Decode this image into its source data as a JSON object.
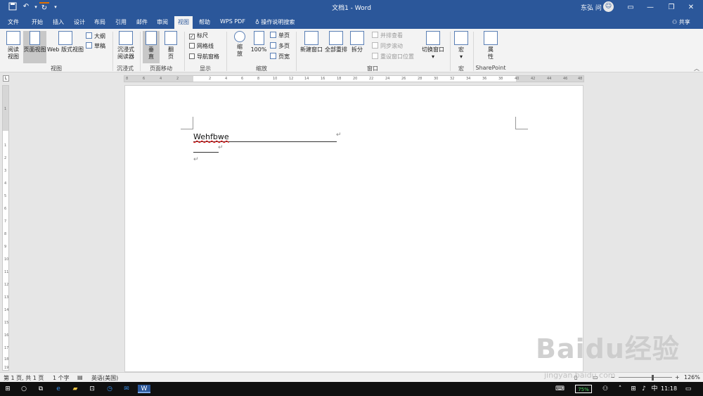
{
  "titlebar": {
    "doc_title": "文档1 - Word",
    "user_name": "东弘 问",
    "avatar_icon": "user-icon",
    "minimize": "—",
    "restore": "❐",
    "close": "✕"
  },
  "tabs": [
    {
      "label": "文件"
    },
    {
      "label": "开始"
    },
    {
      "label": "插入"
    },
    {
      "label": "设计"
    },
    {
      "label": "布局"
    },
    {
      "label": "引用"
    },
    {
      "label": "邮件"
    },
    {
      "label": "审阅"
    },
    {
      "label": "视图"
    },
    {
      "label": "帮助"
    },
    {
      "label": "WPS PDF"
    }
  ],
  "tell_me": "操作说明搜索",
  "share": "共享",
  "ribbon": {
    "views": {
      "read_mode": "阅读视图",
      "print_layout": "页面视图",
      "web_layout": "Web 版式视图",
      "outline": "大纲",
      "draft": "草稿",
      "group": "视图"
    },
    "immersive": {
      "reader": "沉浸式阅读器",
      "group": "沉浸式"
    },
    "page_movement": {
      "vertical": "垂直",
      "side_to_side": "翻页",
      "group": "页面移动"
    },
    "show": {
      "ruler": "标尺",
      "gridlines": "网格线",
      "nav_pane": "导航窗格",
      "group": "显示"
    },
    "zoom": {
      "zoom": "缩放",
      "hundred": "100%",
      "one_page": "单页",
      "multi_page": "多页",
      "page_width": "页宽",
      "group": "缩放"
    },
    "window": {
      "new_window": "新建窗口",
      "arrange_all": "全部重排",
      "split": "拆分",
      "side_by_side": "并排查看",
      "sync_scroll": "同步滚动",
      "reset_pos": "重设窗口位置",
      "switch_windows": "切换窗口",
      "group": "窗口"
    },
    "macros": {
      "macros": "宏",
      "group": "宏"
    },
    "sharepoint": {
      "properties": "属性",
      "group": "SharePoint"
    }
  },
  "hruler_ticks": [
    "8",
    "6",
    "4",
    "2",
    "2",
    "4",
    "6",
    "8",
    "10",
    "12",
    "14",
    "16",
    "18",
    "20",
    "22",
    "24",
    "26",
    "28",
    "30",
    "32",
    "34",
    "36",
    "38",
    "40",
    "42",
    "44",
    "46",
    "48"
  ],
  "vruler_ticks": [
    "1",
    "1",
    "2",
    "3",
    "4",
    "5",
    "6",
    "7",
    "8",
    "9",
    "10",
    "11",
    "12",
    "13",
    "14",
    "15",
    "16",
    "17",
    "18",
    "19"
  ],
  "document": {
    "line1": "Wehfbwe",
    "mark": "↵"
  },
  "statusbar": {
    "page": "第 1 页, 共 1 页",
    "words": "1 个字",
    "language": "英语(美国)",
    "zoom": "126%"
  },
  "taskbar": {
    "battery": "75%",
    "ime": "中",
    "time": "11:18"
  },
  "watermark": {
    "brand": "Baidu经验",
    "url": "jingyan.baidu.com"
  },
  "colors": {
    "word_blue": "#2b579a",
    "ribbon_bg": "#f3f3f3",
    "spell_error": "#e00000"
  }
}
